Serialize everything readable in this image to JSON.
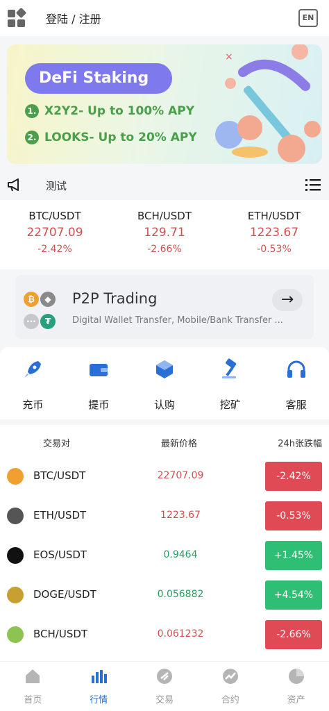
{
  "header": {
    "login": "登陆 / 注册",
    "lang": "EN"
  },
  "banner": {
    "pill": "DeFi Staking",
    "line1_num": "1.",
    "line1": "X2Y2- Up to 100% APY",
    "line2_num": "2.",
    "line2": "LOOKS- Up to 20% APY"
  },
  "notice": {
    "text": "测试"
  },
  "tickers": [
    {
      "pair": "BTC/USDT",
      "price": "22707.09",
      "change": "-2.42%"
    },
    {
      "pair": "BCH/USDT",
      "price": "129.71",
      "change": "-2.66%"
    },
    {
      "pair": "ETH/USDT",
      "price": "1223.67",
      "change": "-0.53%"
    }
  ],
  "p2p": {
    "title": "P2P Trading",
    "subtitle": "Digital Wallet Transfer, Mobile/Bank Transfer ...",
    "arrow": "→"
  },
  "quick": [
    {
      "label": "充币",
      "icon": "rocket-icon"
    },
    {
      "label": "提币",
      "icon": "wallet-icon"
    },
    {
      "label": "认购",
      "icon": "cube-icon"
    },
    {
      "label": "挖矿",
      "icon": "hammer-icon"
    },
    {
      "label": "客服",
      "icon": "headset-icon"
    }
  ],
  "market": {
    "headers": {
      "pair": "交易对",
      "price": "最新价格",
      "change": "24h张跌幅"
    },
    "rows": [
      {
        "symbol": "BTC/USDT",
        "price": "22707.09",
        "change": "-2.42%",
        "trend": "down",
        "icon_color": "#f0a030"
      },
      {
        "symbol": "ETH/USDT",
        "price": "1223.67",
        "change": "-0.53%",
        "trend": "down",
        "icon_color": "#555555"
      },
      {
        "symbol": "EOS/USDT",
        "price": "0.9464",
        "change": "+1.45%",
        "trend": "up",
        "icon_color": "#111111"
      },
      {
        "symbol": "DOGE/USDT",
        "price": "0.056882",
        "change": "+4.54%",
        "trend": "up",
        "icon_color": "#c8a032"
      },
      {
        "symbol": "BCH/USDT",
        "price": "0.061232",
        "change": "-2.66%",
        "trend": "down",
        "icon_color": "#8dc351"
      }
    ]
  },
  "tabs": [
    {
      "label": "首页",
      "icon": "home-icon"
    },
    {
      "label": "行情",
      "icon": "chart-icon",
      "active": true
    },
    {
      "label": "交易",
      "icon": "exchange-icon"
    },
    {
      "label": "合约",
      "icon": "trend-icon"
    },
    {
      "label": "资产",
      "icon": "pie-icon"
    }
  ],
  "colors": {
    "down": "#e04a55",
    "up": "#2fbf74",
    "accent": "#2a6fd6",
    "banner_pill": "#7e79ec"
  }
}
